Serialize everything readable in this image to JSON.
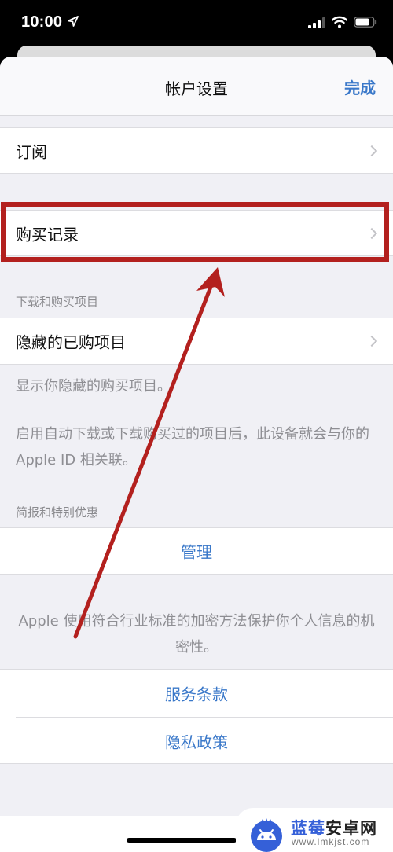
{
  "status_bar": {
    "time": "10:00",
    "icons": [
      "location-arrow-icon",
      "cellular-signal-icon",
      "wifi-icon",
      "battery-icon"
    ]
  },
  "nav": {
    "title": "帐户设置",
    "done_label": "完成"
  },
  "rows": {
    "subscriptions": "订阅",
    "purchase_history": "购买记录",
    "hidden_purchases": "隐藏的已购项目"
  },
  "sections": {
    "downloads_header": "下载和购买项目",
    "hidden_footer": "显示你隐藏的购买项目。",
    "auto_download_footer": "启用自动下载或下载购买过的项目后，此设备就会与你的 Apple ID 相关联。",
    "newsletters_header": "简报和特别优惠",
    "manage_label": "管理",
    "privacy_footer": "Apple 使用符合行业标准的加密方法保护你个人信息的机密性。",
    "terms_label": "服务条款",
    "privacy_policy_label": "隐私政策"
  },
  "annotation": {
    "highlight_target": "购买记录",
    "color": "#b3201e"
  },
  "watermark": {
    "title_blue": "蓝莓",
    "title_dark": "安卓网",
    "url": "www.lmkjst.com"
  },
  "colors": {
    "link_blue": "#3a78c9",
    "grouped_background": "#f0f0f5",
    "annotation_red": "#b3201e"
  }
}
